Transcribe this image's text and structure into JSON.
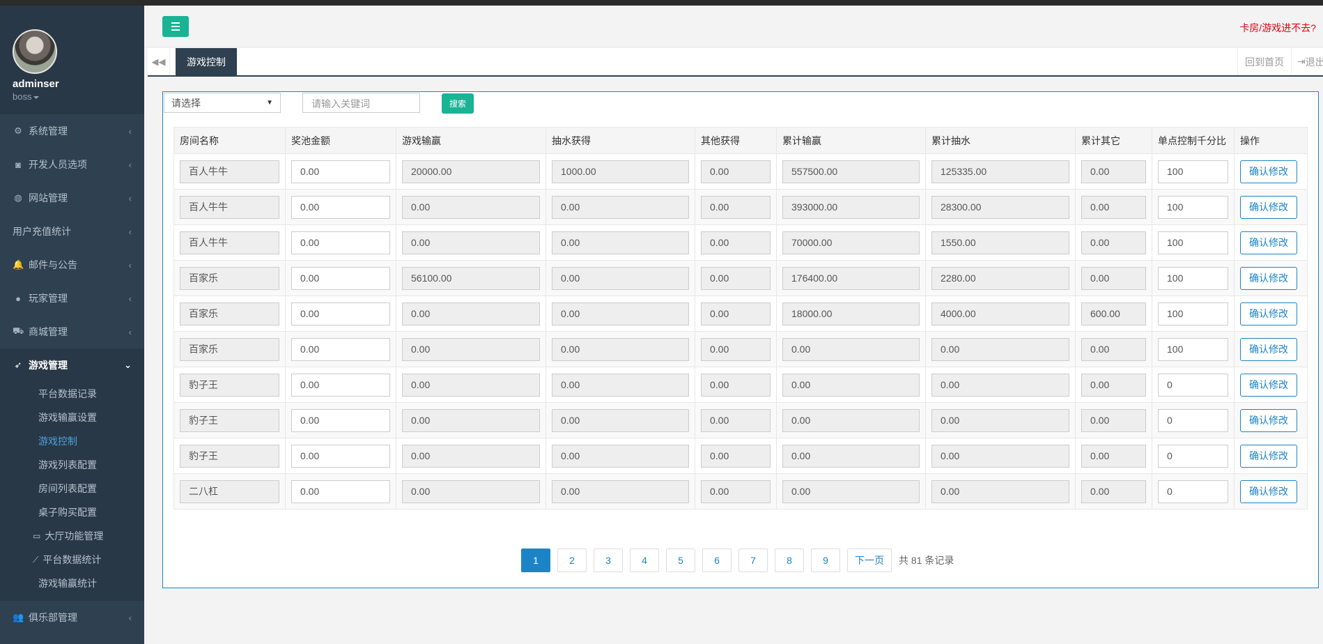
{
  "user": {
    "name": "adminser",
    "role": "boss"
  },
  "sidebar": {
    "items": [
      {
        "icon": "gears-icon",
        "glyph": "⚙",
        "label": "系统管理"
      },
      {
        "icon": "gamepad-icon",
        "glyph": "◙",
        "label": "开发人员选项"
      },
      {
        "icon": "globe-icon",
        "glyph": "◍",
        "label": "网站管理"
      },
      {
        "icon": "",
        "glyph": "",
        "label": "用户充值统计"
      },
      {
        "icon": "bell-icon",
        "glyph": "🔔",
        "label": "邮件与公告"
      },
      {
        "icon": "user-icon",
        "glyph": "●",
        "label": "玩家管理"
      },
      {
        "icon": "cart-icon",
        "glyph": "⛟",
        "label": "商城管理"
      }
    ],
    "active": {
      "icon": "rocket-icon",
      "glyph": "➶",
      "label": "游戏管理"
    },
    "sub_items": [
      {
        "label": "平台数据记录"
      },
      {
        "label": "游戏输赢设置"
      },
      {
        "label": "游戏控制"
      },
      {
        "label": "游戏列表配置"
      },
      {
        "label": "房间列表配置"
      },
      {
        "label": "桌子购买配置"
      },
      {
        "label": "大厅功能管理"
      },
      {
        "label": "平台数据统计"
      },
      {
        "label": "游戏输赢统计"
      }
    ],
    "bottom": {
      "icon": "users-icon",
      "glyph": "👥",
      "label": "俱乐部管理"
    }
  },
  "topbar": {
    "notice": "卡房/游戏进不去?"
  },
  "tabs": {
    "active": "游戏控制",
    "home": "回到首页",
    "exit": "退出"
  },
  "filters": {
    "select_value": "请选择",
    "search_placeholder": "请输入关键词",
    "search_button": "搜索"
  },
  "table": {
    "headers": [
      "房间名称",
      "奖池金额",
      "游戏输赢",
      "抽水获得",
      "其他获得",
      "累计输赢",
      "累计抽水",
      "累计其它",
      "单点控制千分比",
      "操作"
    ],
    "action_label": "确认修改",
    "rows": [
      [
        "百人牛牛",
        "0.00",
        "20000.00",
        "1000.00",
        "0.00",
        "557500.00",
        "125335.00",
        "0.00",
        "100"
      ],
      [
        "百人牛牛",
        "0.00",
        "0.00",
        "0.00",
        "0.00",
        "393000.00",
        "28300.00",
        "0.00",
        "100"
      ],
      [
        "百人牛牛",
        "0.00",
        "0.00",
        "0.00",
        "0.00",
        "70000.00",
        "1550.00",
        "0.00",
        "100"
      ],
      [
        "百家乐",
        "0.00",
        "56100.00",
        "0.00",
        "0.00",
        "176400.00",
        "2280.00",
        "0.00",
        "100"
      ],
      [
        "百家乐",
        "0.00",
        "0.00",
        "0.00",
        "0.00",
        "18000.00",
        "4000.00",
        "600.00",
        "100"
      ],
      [
        "百家乐",
        "0.00",
        "0.00",
        "0.00",
        "0.00",
        "0.00",
        "0.00",
        "0.00",
        "100"
      ],
      [
        "豹子王",
        "0.00",
        "0.00",
        "0.00",
        "0.00",
        "0.00",
        "0.00",
        "0.00",
        "0"
      ],
      [
        "豹子王",
        "0.00",
        "0.00",
        "0.00",
        "0.00",
        "0.00",
        "0.00",
        "0.00",
        "0"
      ],
      [
        "豹子王",
        "0.00",
        "0.00",
        "0.00",
        "0.00",
        "0.00",
        "0.00",
        "0.00",
        "0"
      ],
      [
        "二八杠",
        "0.00",
        "0.00",
        "0.00",
        "0.00",
        "0.00",
        "0.00",
        "0.00",
        "0"
      ]
    ]
  },
  "pagination": {
    "pages": [
      "1",
      "2",
      "3",
      "4",
      "5",
      "6",
      "7",
      "8",
      "9"
    ],
    "current": "1",
    "next": "下一页",
    "total": "共 81 条记录"
  }
}
